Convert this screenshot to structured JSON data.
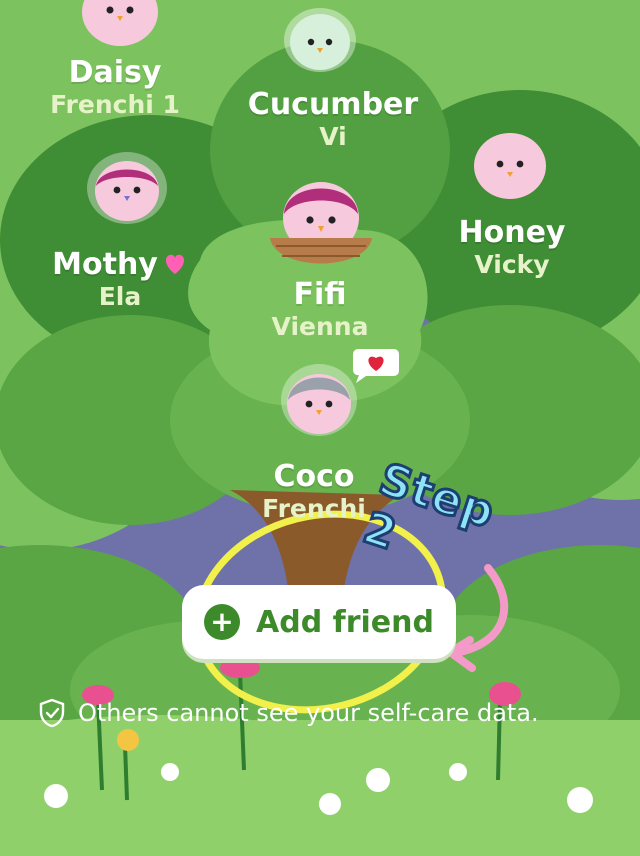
{
  "friends": [
    {
      "name": "Daisy",
      "owner": "Frenchi 1"
    },
    {
      "name": "Cucumber",
      "owner": "Vi"
    },
    {
      "name": "Mothy",
      "owner": "Ela"
    },
    {
      "name": "Honey",
      "owner": "Vicky"
    },
    {
      "name": "Fifi",
      "owner": "Vienna"
    },
    {
      "name": "Coco",
      "owner": "Frenchi"
    }
  ],
  "annotation": {
    "step_label": "Step 2"
  },
  "add_friend": {
    "label": "Add friend",
    "icon": "plus-icon"
  },
  "privacy": {
    "note": "Others cannot see your self-care data.",
    "icon": "shield-check-icon"
  },
  "colors": {
    "sky": "#6f72a8",
    "tree_light": "#7cc35f",
    "tree_mid": "#5aa644",
    "tree_dark": "#2f7d2f",
    "trunk": "#8a5a2b",
    "grass": "#8fd06b",
    "button_green": "#3c8a2a",
    "bird_pink": "#f7c9dc",
    "highlight_yellow": "#f2f04a",
    "arrow_pink": "#f39ac8"
  }
}
